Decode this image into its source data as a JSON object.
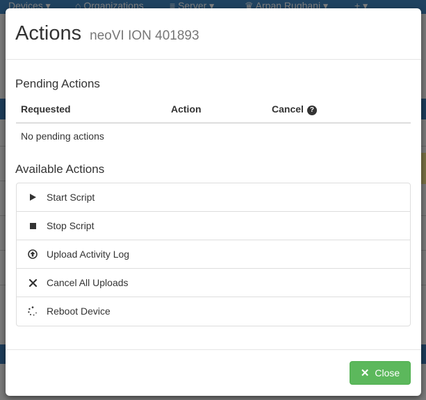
{
  "navbar": {
    "items": [
      {
        "label": "Devices",
        "icon": "caret-down-icon"
      },
      {
        "label": "Organizations",
        "icon": "building-icon"
      },
      {
        "label": "Server",
        "icon": "database-icon"
      },
      {
        "label": "Arpan Rughani",
        "icon": "crown-icon"
      },
      {
        "label": "+",
        "icon": "caret-down-icon"
      }
    ]
  },
  "modal": {
    "title": "Actions",
    "subtitle": "neoVI ION 401893",
    "pending": {
      "heading": "Pending Actions",
      "columns": [
        "Requested",
        "Action",
        "Cancel"
      ],
      "empty_text": "No pending actions"
    },
    "available": {
      "heading": "Available Actions",
      "items": [
        {
          "label": "Start Script",
          "icon": "play-icon"
        },
        {
          "label": "Stop Script",
          "icon": "stop-icon"
        },
        {
          "label": "Upload Activity Log",
          "icon": "upload-circle-icon"
        },
        {
          "label": "Cancel All Uploads",
          "icon": "x-icon"
        },
        {
          "label": "Reboot Device",
          "icon": "spinner-icon"
        }
      ]
    },
    "footer": {
      "close_label": "Close"
    }
  },
  "colors": {
    "primary_button": "#5cb85c",
    "navbar": "#3f84c0"
  }
}
